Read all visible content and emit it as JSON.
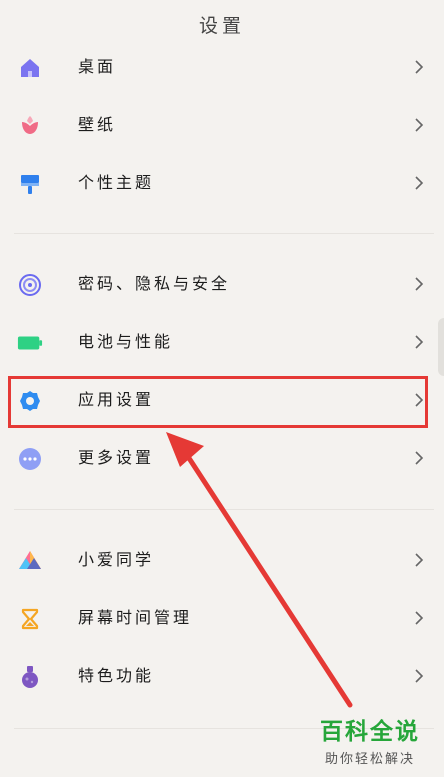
{
  "header": {
    "title": "设置"
  },
  "settings": {
    "group1": [
      {
        "label": "桌面"
      },
      {
        "label": "壁纸"
      },
      {
        "label": "个性主题"
      }
    ],
    "group2": [
      {
        "label": "密码、隐私与安全"
      },
      {
        "label": "电池与性能"
      },
      {
        "label": "应用设置"
      },
      {
        "label": "更多设置"
      }
    ],
    "group3": [
      {
        "label": "小爱同学"
      },
      {
        "label": "屏幕时间管理"
      },
      {
        "label": "特色功能"
      }
    ]
  },
  "watermark": {
    "title": "百科全说",
    "subtitle": "助你轻松解决"
  },
  "colors": {
    "highlight": "#e53935",
    "arrow": "#e53935",
    "watermark": "#26a63a",
    "icon_desktop": "#7b74f0",
    "icon_wallpaper": "#f06b86",
    "icon_theme": "#2f80ed",
    "icon_security": "#6a6af0",
    "icon_battery": "#2ed184",
    "icon_apps": "#2f8cf0",
    "icon_more": "#8f9ff5"
  }
}
